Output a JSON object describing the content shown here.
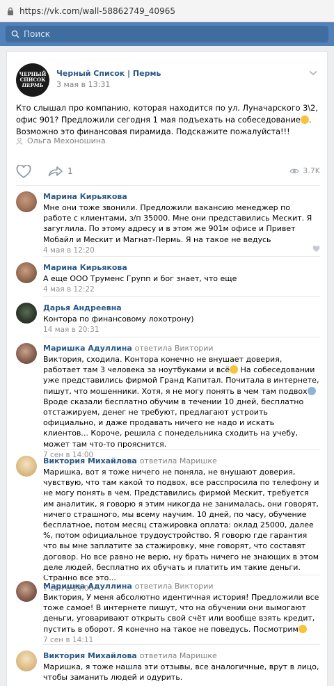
{
  "browser": {
    "url": "https://vk.com/wall-58862749_40965"
  },
  "header": {
    "search_placeholder": "Поиск"
  },
  "post": {
    "logo": {
      "line1": "ЧЕРНЫЙ",
      "line2": "СПИСОК",
      "line3": "ПЕРМЬ"
    },
    "group_name": "Черный Список | Пермь",
    "date": "3 мая в 13:31",
    "text_part1": "Кто слышал про компанию, которая находится по ул. Луначарского 3\\2, офис 901? Предложили сегодня 1 мая подъехать на собеседование",
    "text_part2": ". Возможно это финансовая пирамида. Подскажите пожалуйста!!!",
    "author": "Ольга Мехоношина",
    "shares": "1",
    "views": "3.7K"
  },
  "comments": [
    {
      "name": "Марина Кирьякова",
      "text": "Мне они тоже звонили. Предложили вакансию менеджер по работе с клиентами, з/п 35000. Мне они представились Мескит. Я загуглила. По этому адресу и в этом же 901м офисе и Привет Мобайл и Мескит и Магнат-Пермь. Я на такое не ведусь",
      "date": "4 мая в 12:20"
    },
    {
      "name": "Марина Кирьякова",
      "text": "А еще ООО Труменс Групп и бог знает, что еще",
      "date": "4 мая в 12:22"
    },
    {
      "name": "Дарья Андреевна",
      "text": "Контора по финансовому лохотрону)",
      "date": "14 мая в 20:31"
    },
    {
      "name": "Маришка Адуллина",
      "reply": "ответила Виктории",
      "text_a": "Виктория, сходила. Контора конечно не внушает доверия, работает там 3 человека за ноутбуками и всё",
      "text_b": " На собеседовании уже представились фирмой Гранд Капитал. Почитала в интернете, пишут, что мошенники. Хотя, я не могу понять в чем там подвох",
      "text_c": " Вроде сказали бесплатно обучим в течении 10 дней, бесплатно отстажируем, денег не требуют, предлагают устроить официально, и даже продавать ничего не надо и искать клиентов... Короче, решила с понедельника сходить на учебу, может там что-то прояснится.",
      "date": "7 сен в 14:00"
    },
    {
      "name": "Виктория Михайлова",
      "reply": "ответила Маришке",
      "text": "Маришка, вот я тоже ничего не поняла, не внушают доверия, чувствую, что там какой то подвох, все расспросила по телефону и не могу понять в чем. Представились фирмой Мескит, требуется им аналитик, я говорю я этим никогда не занималась, они говорят, ничего страшного, мы всему научим. 10 дней, по часу, обучение бесплатное, потом месяц стажировка оплата: оклад 25000, далее %, потом официальное трудоустройство. Я говорю где гарантия что вы мне заплатите за стажировку, мне говорят, что составят договор. Но все равно не верю, ну брать ничего не знающих в этом деле людей, бесплатно их обучать и платить им такие деньги. Странно все это...",
      "date": "7 сен в 14:06"
    },
    {
      "name": "Маришка Адуллина",
      "reply": "ответила Виктории",
      "text": "Виктория, У меня абсолютно идентичная история! Предложили все тоже самое! В интернете пишут, что на обучении они вымогают деньги, уговаривают открыть свой счёт или вообще взять кредит, пустить в оборот. Я конечно на такое не поведусь. Посмотрим",
      "date": "7 сен в 14:11"
    },
    {
      "name": "Виктория Михайлова",
      "reply": "ответила Маришке",
      "text": "Маришка, я тоже нашла эти отзывы, все аналогичные, врут в лицо, чтобы заманить людей и одурить."
    }
  ],
  "colors": {
    "vk_header": "#5181b8",
    "link_blue": "#2a5885",
    "muted": "#828282",
    "background": "#edeef0"
  },
  "icons": [
    "lock-icon",
    "search-icon",
    "chevron-down-icon",
    "user-icon",
    "heart-icon",
    "share-icon",
    "eye-icon",
    "emoji-icon"
  ]
}
